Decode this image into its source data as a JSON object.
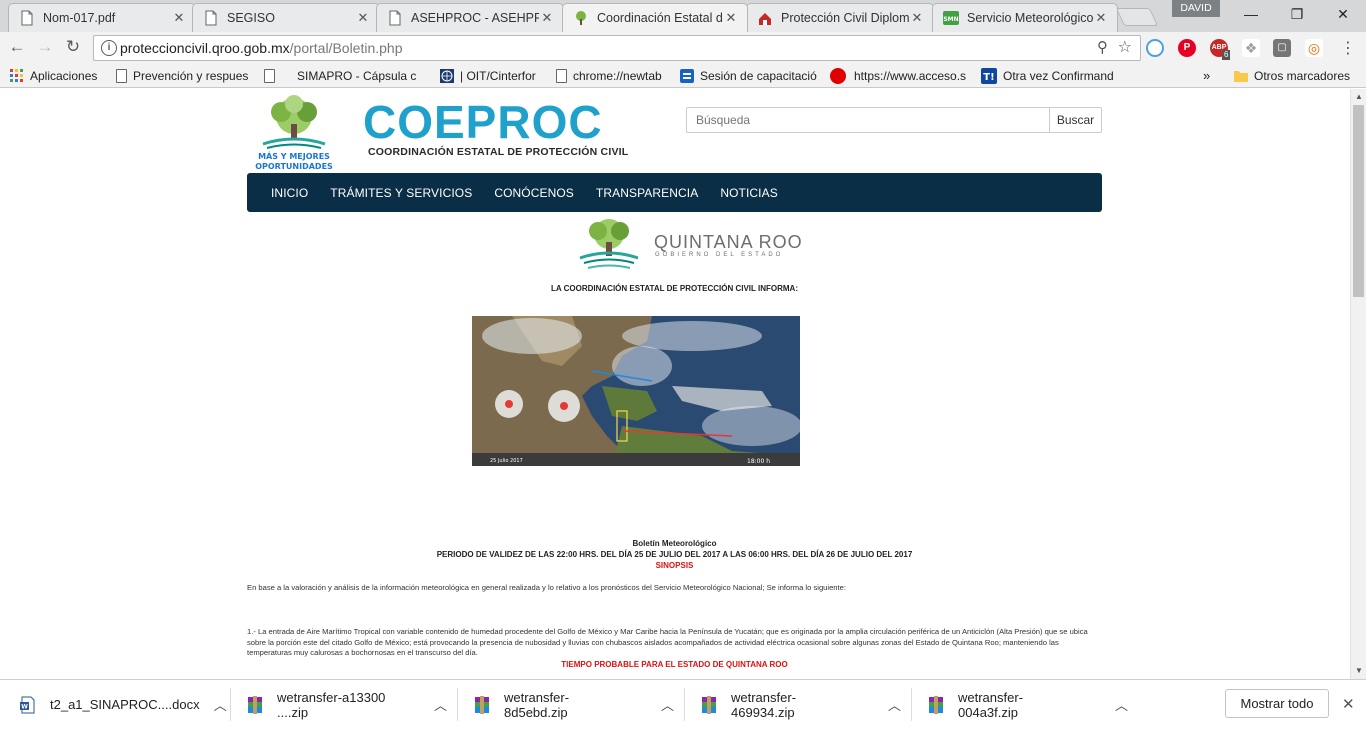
{
  "browser": {
    "tabs": [
      {
        "label": "Nom-017.pdf",
        "icon": "document-icon",
        "active": false
      },
      {
        "label": "SEGISO",
        "icon": "document-icon",
        "active": false
      },
      {
        "label": "ASEHPROC - ASEHPROC",
        "icon": "document-icon",
        "active": false
      },
      {
        "label": "Coordinación Estatal de",
        "icon": "tree-logo-icon",
        "active": true
      },
      {
        "label": "Protección Civil Diplom",
        "icon": "site-icon",
        "active": false
      },
      {
        "label": "Servicio Meteorológico",
        "icon": "smn-icon",
        "active": false
      }
    ],
    "profile_name": "DAVID",
    "url_host": "proteccioncivil.qroo.gob.mx",
    "url_path": "/portal/Boletin.php",
    "extension_badge": "6",
    "bookmarks": [
      {
        "label": "Aplicaciones",
        "icon": "apps-grid-icon"
      },
      {
        "label": "Prevención y respues",
        "icon": "document-icon"
      },
      {
        "label": "SIMAPRO - Cápsula c",
        "icon": "document-icon"
      },
      {
        "label": "| OIT/Cinterfor",
        "icon": "globe-icon"
      },
      {
        "label": "chrome://newtab",
        "icon": "document-icon"
      },
      {
        "label": "Sesión de capacitació",
        "icon": "training-icon"
      },
      {
        "label": "https://www.acceso.s",
        "icon": "red-dot-icon"
      },
      {
        "label": "Otra vez Confirmand",
        "icon": "t-icon"
      }
    ],
    "bookmarks_overflow": "»",
    "other_bookmarks": "Otros marcadores",
    "colors": {
      "tab_bar": "#d5d7d9",
      "toolbar": "#f2f2f2"
    }
  },
  "site": {
    "logo_tagline": "MÁS Y MEJORES OPORTUNIDADES",
    "brand_title": "COEPROC",
    "brand_subtitle": "COORDINACIÓN ESTATAL DE PROTECCIÓN CIVIL",
    "search": {
      "placeholder": "Búsqueda",
      "button": "Buscar"
    },
    "nav": [
      "INICIO",
      "TRÁMITES Y SERVICIOS",
      "CONÓCENOS",
      "TRANSPARENCIA",
      "NOTICIAS"
    ],
    "gov_name": "QUINTANA ROO",
    "gov_sub": "GOBIERNO DEL ESTADO",
    "informa": "LA COORDINACIÓN ESTATAL DE PROTECCIÓN CIVIL INFORMA:",
    "map_caption_date": "25 Julio 2017",
    "map_caption_time": "18:00 h",
    "colors": {
      "brand": "#1fa1cc",
      "nav_bg": "#0a2e45",
      "alert_red": "#d11111"
    }
  },
  "bulletin": {
    "title": "Boletín Meteorológico",
    "period": "PERIODO DE VALIDEZ DE LAS 22:00 HRS. DEL DÍA 25 DE JULIO DEL 2017 A LAS 06:00 HRS. DEL DÍA 26 DE JULIO DEL 2017",
    "sinopsis": "SINOPSIS",
    "intro": "En base a la valoración y análisis de la información meteorológica en general realizada y lo relativo a los pronósticos del Servicio Meteorológico Nacional; Se informa lo siguiente:",
    "point1": "1.- La entrada de Aire Marítimo Tropical con variable contenido de humedad procedente del Golfo de México y Mar Caribe hacia la Península de Yucatán; que es originada por la amplia circulación periférica de un Anticiclón (Alta Presión) que se ubica sobre la porción este del citado Golfo de México; está provocando la presencia de nubosidad y lluvias con chubascos aislados acompañados de actividad eléctrica ocasional sobre algunas zonas del Estado de Quintana Roo; manteniendo las temperaturas muy calurosas a bochornosas en el transcurso del día.",
    "forecast_heading": "TIEMPO PROBABLE PARA EL ESTADO DE QUINTANA ROO"
  },
  "downloads": {
    "items": [
      {
        "label": "t2_a1_SINAPROC....docx",
        "icon": "word-file-icon"
      },
      {
        "label": "wetransfer-a13300 ....zip",
        "icon": "zip-archive-icon"
      },
      {
        "label": "wetransfer-8d5ebd.zip",
        "icon": "zip-archive-icon"
      },
      {
        "label": "wetransfer-469934.zip",
        "icon": "zip-archive-icon"
      },
      {
        "label": "wetransfer-004a3f.zip",
        "icon": "zip-archive-icon"
      }
    ],
    "show_all": "Mostrar todo"
  }
}
